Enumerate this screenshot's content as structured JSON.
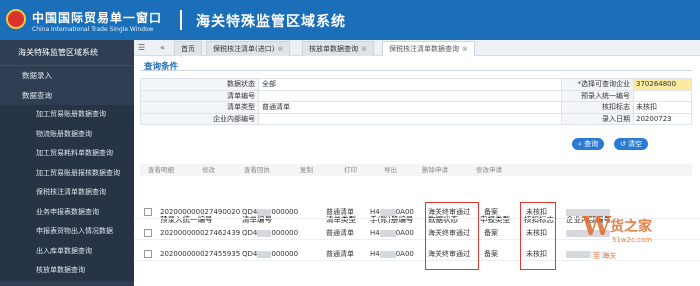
{
  "header": {
    "logo_cn": "中国国际贸易单一窗口",
    "logo_en": "China International Trade Single Window",
    "system_title": "海关特殊监管区域系统"
  },
  "sidebar": {
    "title": "海关特殊监管区域系统",
    "items": [
      {
        "label": "数据录入",
        "sub": false
      },
      {
        "label": "数据查询",
        "sub": false
      },
      {
        "label": "加工贸易账册数据查询",
        "sub": true
      },
      {
        "label": "物流账册数据查询",
        "sub": true
      },
      {
        "label": "加工贸易耗料单数据查询",
        "sub": true
      },
      {
        "label": "加工贸易账册报核数据查询",
        "sub": true
      },
      {
        "label": "保税核注清单数据查询",
        "sub": true
      },
      {
        "label": "业务申报表数据查询",
        "sub": true
      },
      {
        "label": "申报表货物出入情况数据",
        "sub": true
      },
      {
        "label": "出入库单数据查询",
        "sub": true
      },
      {
        "label": "核放单数据查询",
        "sub": true
      }
    ]
  },
  "tabs": [
    {
      "label": "首页",
      "closable": false,
      "active": false
    },
    {
      "label": "保税核注清单(进口)",
      "closable": true,
      "active": false
    },
    {
      "label": "核放单数据查询",
      "closable": true,
      "active": false
    },
    {
      "label": "保税核注清单数据查询",
      "closable": true,
      "active": true
    }
  ],
  "query": {
    "section_title": "查询条件",
    "rows": [
      {
        "l1": "数据状态",
        "v1": "全部",
        "l2": "*选择可查询企业",
        "v2": "370264800"
      },
      {
        "l1": "清单编号",
        "v1": "",
        "l2": "预录入统一编号",
        "v2": ""
      },
      {
        "l1": "清单类型",
        "v1": "普通清单",
        "l2": "核扣标志",
        "v2": "未核扣"
      },
      {
        "l1": "企业内部编号",
        "v1": "",
        "l2": "录入日期",
        "v2": "20200723"
      }
    ],
    "search_label": "查询",
    "reset_label": "清空"
  },
  "toolbar": [
    "查看明细",
    "修改",
    "查看回执",
    "复制",
    "打印",
    "导出",
    "删除申请",
    "修改申请"
  ],
  "grid": {
    "headers": [
      "预录入统一编号",
      "清单编号",
      "清单类型",
      "手(账)册编号",
      "数据状态",
      "申报类型",
      "核扣标志",
      "企业内部编号"
    ],
    "rows": [
      {
        "preentry": "202000000027490020",
        "list_no_prefix": "QD4",
        "list_no_suffix": "000000",
        "type": "普通清单",
        "book_prefix": "H4",
        "book_suffix": "0A00",
        "status": "海关终审通过",
        "decl_type": "备案",
        "flag": "未核扣"
      },
      {
        "preentry": "202000000027462439",
        "list_no_prefix": "QD4",
        "list_no_suffix": "000000",
        "type": "普通清单",
        "book_prefix": "H4",
        "book_suffix": "0A00",
        "status": "海关终审通过",
        "decl_type": "备案",
        "flag": "未核扣"
      },
      {
        "preentry": "202000000027455935",
        "list_no_prefix": "QD4",
        "list_no_suffix": "000000",
        "type": "普通清单",
        "book_prefix": "H4",
        "book_suffix": "0A00",
        "status": "海关终审通过",
        "decl_type": "备案",
        "flag": "未核扣"
      }
    ]
  },
  "watermark": {
    "cn": "货之家",
    "url": "51w2c.com",
    "tag": "至 海关"
  },
  "colors": {
    "header_bg": "#1a6fb8",
    "sidebar_bg": "#2f3e52",
    "accent": "#2a7bd1",
    "highlight": "#e0382e",
    "watermark": "#e06b2c"
  }
}
